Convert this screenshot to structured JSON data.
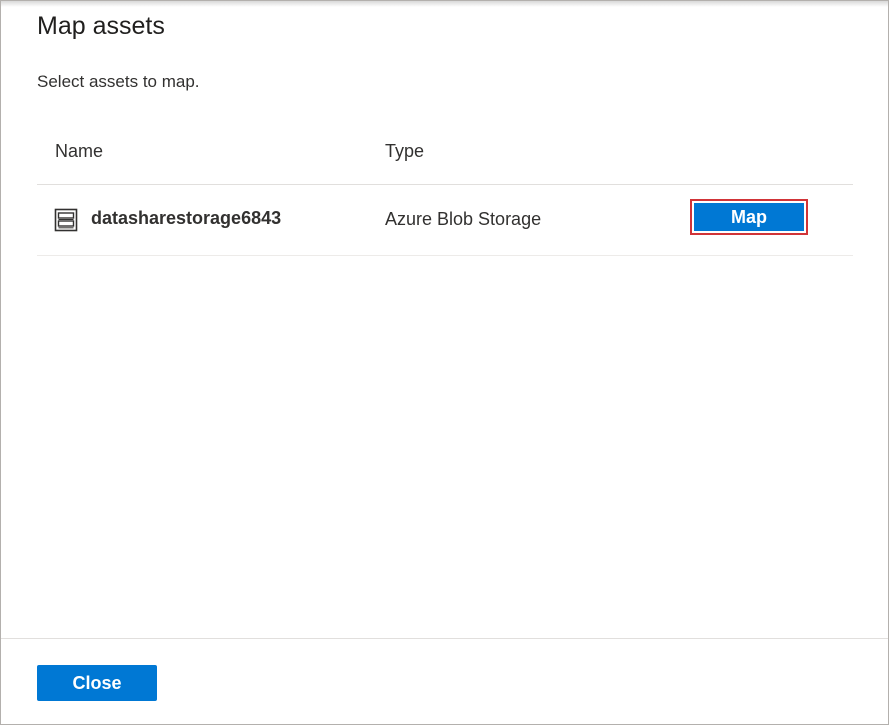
{
  "dialog": {
    "title": "Map assets",
    "subtitle": "Select assets to map."
  },
  "table": {
    "columns": [
      "Name",
      "Type"
    ],
    "rows": [
      {
        "icon": "storage-icon",
        "name": "datasharestorage6843",
        "type": "Azure Blob Storage",
        "action_label": "Map"
      }
    ]
  },
  "footer": {
    "close_label": "Close"
  },
  "colors": {
    "primary": "#0078d4",
    "highlight_border": "#d13438"
  }
}
